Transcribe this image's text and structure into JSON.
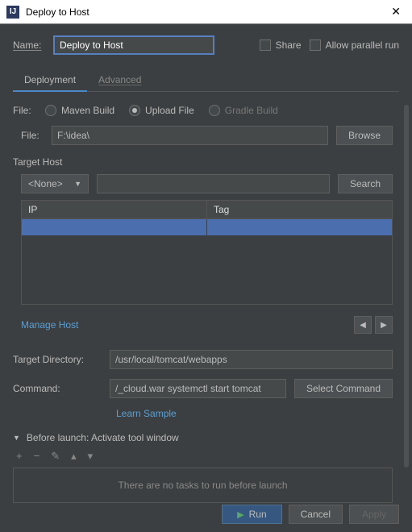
{
  "window": {
    "title": "Deploy to Host"
  },
  "name": {
    "label": "Name:",
    "value": "Deploy to Host"
  },
  "options": {
    "share": "Share",
    "parallel": "Allow parallel run"
  },
  "tabs": {
    "deployment": "Deployment",
    "advanced": "Advanced"
  },
  "fileType": {
    "label": "File:",
    "maven": "Maven Build",
    "upload": "Upload File",
    "gradle": "Gradle Build"
  },
  "file": {
    "label": "File:",
    "value": "F:\\idea\\",
    "browse": "Browse"
  },
  "targetHost": {
    "label": "Target Host",
    "dropdown": "<None>",
    "search": "Search",
    "col_ip": "IP",
    "col_tag": "Tag",
    "manage": "Manage Host"
  },
  "targetDir": {
    "label": "Target Directory:",
    "value": "/usr/local/tomcat/webapps"
  },
  "command": {
    "label": "Command:",
    "value": "/_cloud.war systemctl start tomcat",
    "select": "Select Command",
    "learn": "Learn Sample"
  },
  "beforeLaunch": {
    "label": "Before launch: Activate tool window",
    "noTasks": "There are no tasks to run before launch"
  },
  "buttons": {
    "run": "Run",
    "cancel": "Cancel",
    "apply": "Apply"
  }
}
